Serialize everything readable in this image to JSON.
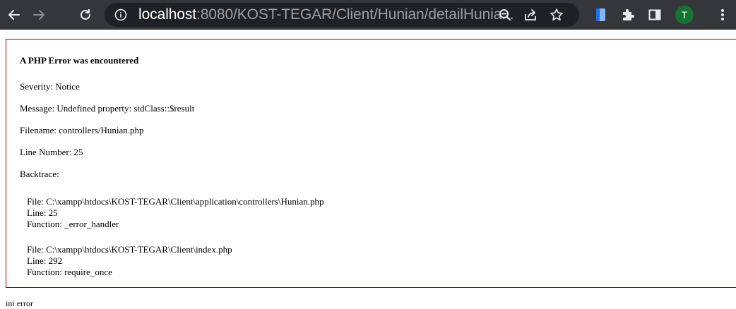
{
  "browser": {
    "url_host": "localhost",
    "url_rest": ":8080/KOST-TEGAR/Client/Hunian/detailHunia...",
    "profile_initial": "T",
    "icons": [
      "back-arrow-icon",
      "forward-arrow-icon",
      "reload-icon",
      "info-icon",
      "zoom-icon",
      "share-icon",
      "star-icon",
      "extension-icon",
      "puzzle-icon",
      "side-panel-icon",
      "more-icon"
    ]
  },
  "error": {
    "heading": "A PHP Error was encountered",
    "severity": "Severity: Notice",
    "message": "Message: Undefined property: stdClass::$result",
    "filename": "Filename: controllers/Hunian.php",
    "line_number": "Line Number: 25",
    "backtrace_label": "Backtrace:",
    "backtrace": [
      {
        "file": "File: C:\\xampp\\htdocs\\KOST-TEGAR\\Client\\application\\controllers\\Hunian.php",
        "line": "Line: 25",
        "function": "Function: _error_handler"
      },
      {
        "file": "File: C:\\xampp\\htdocs\\KOST-TEGAR\\Client\\index.php",
        "line": "Line: 292",
        "function": "Function: require_once"
      }
    ]
  },
  "footer_text": "ini error",
  "colors": {
    "toolbar": "#35363a",
    "omnibox": "#202124",
    "border": "#990000",
    "avatar": "#137333"
  }
}
